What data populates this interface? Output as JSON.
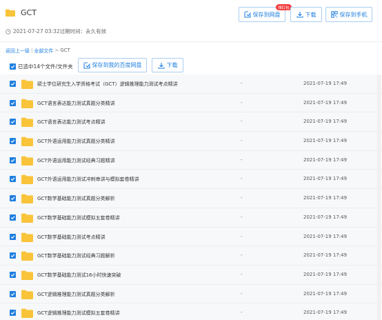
{
  "header": {
    "title": "GCT",
    "timestamp": "2021-07-27 03:32",
    "expiry": "过期时间：永久有效",
    "save_to_drive_label": "保存到网盘",
    "badge_label": "领红包",
    "download_label": "下载",
    "save_to_phone_label": "保存到手机"
  },
  "breadcrumb": {
    "back": "返回上一级",
    "separator": "|",
    "all_files": "全部文件",
    "arrow": ">",
    "current": "GCT"
  },
  "action_bar": {
    "selected_text": "已选中14个文件/文件夹",
    "save_label": "保存到我的百度网盘",
    "download_label": "下载"
  },
  "files": [
    {
      "name": "硕士学位研究生入学资格考试（GCT）逻辑推理能力测试考点精讲",
      "size": "-",
      "date": "2021-07-19 17:49"
    },
    {
      "name": "GCT语言表达能力测试真题分类精讲",
      "size": "-",
      "date": "2021-07-19 17:49"
    },
    {
      "name": "GCT语言表达能力测试考点精讲",
      "size": "-",
      "date": "2021-07-19 17:49"
    },
    {
      "name": "GCT外语运用能力测试真题分类精讲",
      "size": "-",
      "date": "2021-07-19 17:49"
    },
    {
      "name": "GCT外语运用能力测试经典习题精讲",
      "size": "-",
      "date": "2021-07-19 17:49"
    },
    {
      "name": "GCT外语运用能力测试冲刺串讲与模拟套卷精讲",
      "size": "-",
      "date": "2021-07-19 17:49"
    },
    {
      "name": "GCT数学基础能力测试真题分类解析",
      "size": "-",
      "date": "2021-07-19 17:49"
    },
    {
      "name": "GCT数学基础能力测试模拟五套卷精讲",
      "size": "-",
      "date": "2021-07-19 17:49"
    },
    {
      "name": "GCT数学基础能力测试考点精讲",
      "size": "-",
      "date": "2021-07-19 17:49"
    },
    {
      "name": "GCT数学基础能力测试经典习题解析",
      "size": "-",
      "date": "2021-07-19 17:49"
    },
    {
      "name": "GCT数学基础能力测试16小时快速突破",
      "size": "-",
      "date": "2021-07-19 17:49"
    },
    {
      "name": "GCT逻辑推理能力测试真题分类解析",
      "size": "-",
      "date": "2021-07-19 17:49"
    },
    {
      "name": "GCT逻辑推理能力测试模拟五套卷精讲",
      "size": "-",
      "date": "2021-07-19 17:49"
    }
  ],
  "colors": {
    "accent": "#1f7fe0",
    "folder": "#f9c43a",
    "badge": "#f23c3c"
  }
}
